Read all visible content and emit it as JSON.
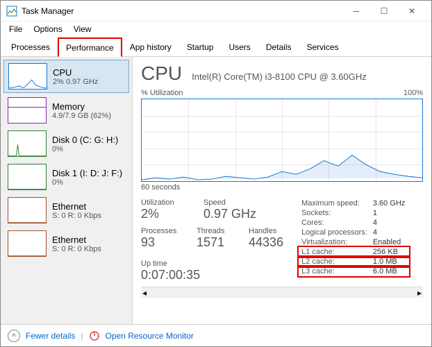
{
  "window": {
    "title": "Task Manager"
  },
  "menu": {
    "file": "File",
    "options": "Options",
    "view": "View"
  },
  "tabs": {
    "processes": "Processes",
    "performance": "Performance",
    "apphistory": "App history",
    "startup": "Startup",
    "users": "Users",
    "details": "Details",
    "services": "Services"
  },
  "sidebar": {
    "items": [
      {
        "title": "CPU",
        "sub": "2% 0.97 GHz",
        "color": "#1976d2"
      },
      {
        "title": "Memory",
        "sub": "4.9/7.9 GB (62%)",
        "color": "#8e24aa"
      },
      {
        "title": "Disk 0 (C: G: H:)",
        "sub": "0%",
        "color": "#2e7d32"
      },
      {
        "title": "Disk 1 (I: D: J: F:)",
        "sub": "0%",
        "color": "#2e7d32"
      },
      {
        "title": "Ethernet",
        "sub": "S: 0 R: 0 Kbps",
        "color": "#a0522d"
      },
      {
        "title": "Ethernet",
        "sub": "S: 0 R: 0 Kbps",
        "color": "#a0522d"
      }
    ]
  },
  "main": {
    "title": "CPU",
    "subtitle": "Intel(R) Core(TM) i3-8100 CPU @ 3.60GHz",
    "chart_top_left": "% Utilization",
    "chart_top_right": "100%",
    "chart_bottom_left": "60 seconds"
  },
  "stats": {
    "utilization_label": "Utilization",
    "utilization": "2%",
    "speed_label": "Speed",
    "speed": "0.97 GHz",
    "processes_label": "Processes",
    "processes": "93",
    "threads_label": "Threads",
    "threads": "1571",
    "handles_label": "Handles",
    "handles": "44336",
    "uptime_label": "Up time",
    "uptime": "0:07:00:35"
  },
  "details": {
    "maxspeed_k": "Maximum speed:",
    "maxspeed_v": "3.60 GHz",
    "sockets_k": "Sockets:",
    "sockets_v": "1",
    "cores_k": "Cores:",
    "cores_v": "4",
    "logical_k": "Logical processors:",
    "logical_v": "4",
    "virt_k": "Virtualization:",
    "virt_v": "Enabled",
    "l1_k": "L1 cache:",
    "l1_v": "256 KB",
    "l2_k": "L2 cache:",
    "l2_v": "1.0 MB",
    "l3_k": "L3 cache:",
    "l3_v": "6.0 MB"
  },
  "footer": {
    "fewer": "Fewer details",
    "resmon": "Open Resource Monitor"
  },
  "chart_data": {
    "type": "line",
    "title": "CPU % Utilization",
    "xlabel": "seconds ago",
    "ylabel": "% Utilization",
    "ylim": [
      0,
      100
    ],
    "x": [
      60,
      57,
      54,
      51,
      48,
      45,
      42,
      39,
      36,
      33,
      30,
      27,
      24,
      21,
      18,
      15,
      12,
      9,
      6,
      3,
      0
    ],
    "values": [
      2,
      4,
      3,
      5,
      2,
      3,
      6,
      4,
      3,
      5,
      12,
      8,
      15,
      25,
      18,
      32,
      20,
      12,
      8,
      6,
      4
    ]
  }
}
